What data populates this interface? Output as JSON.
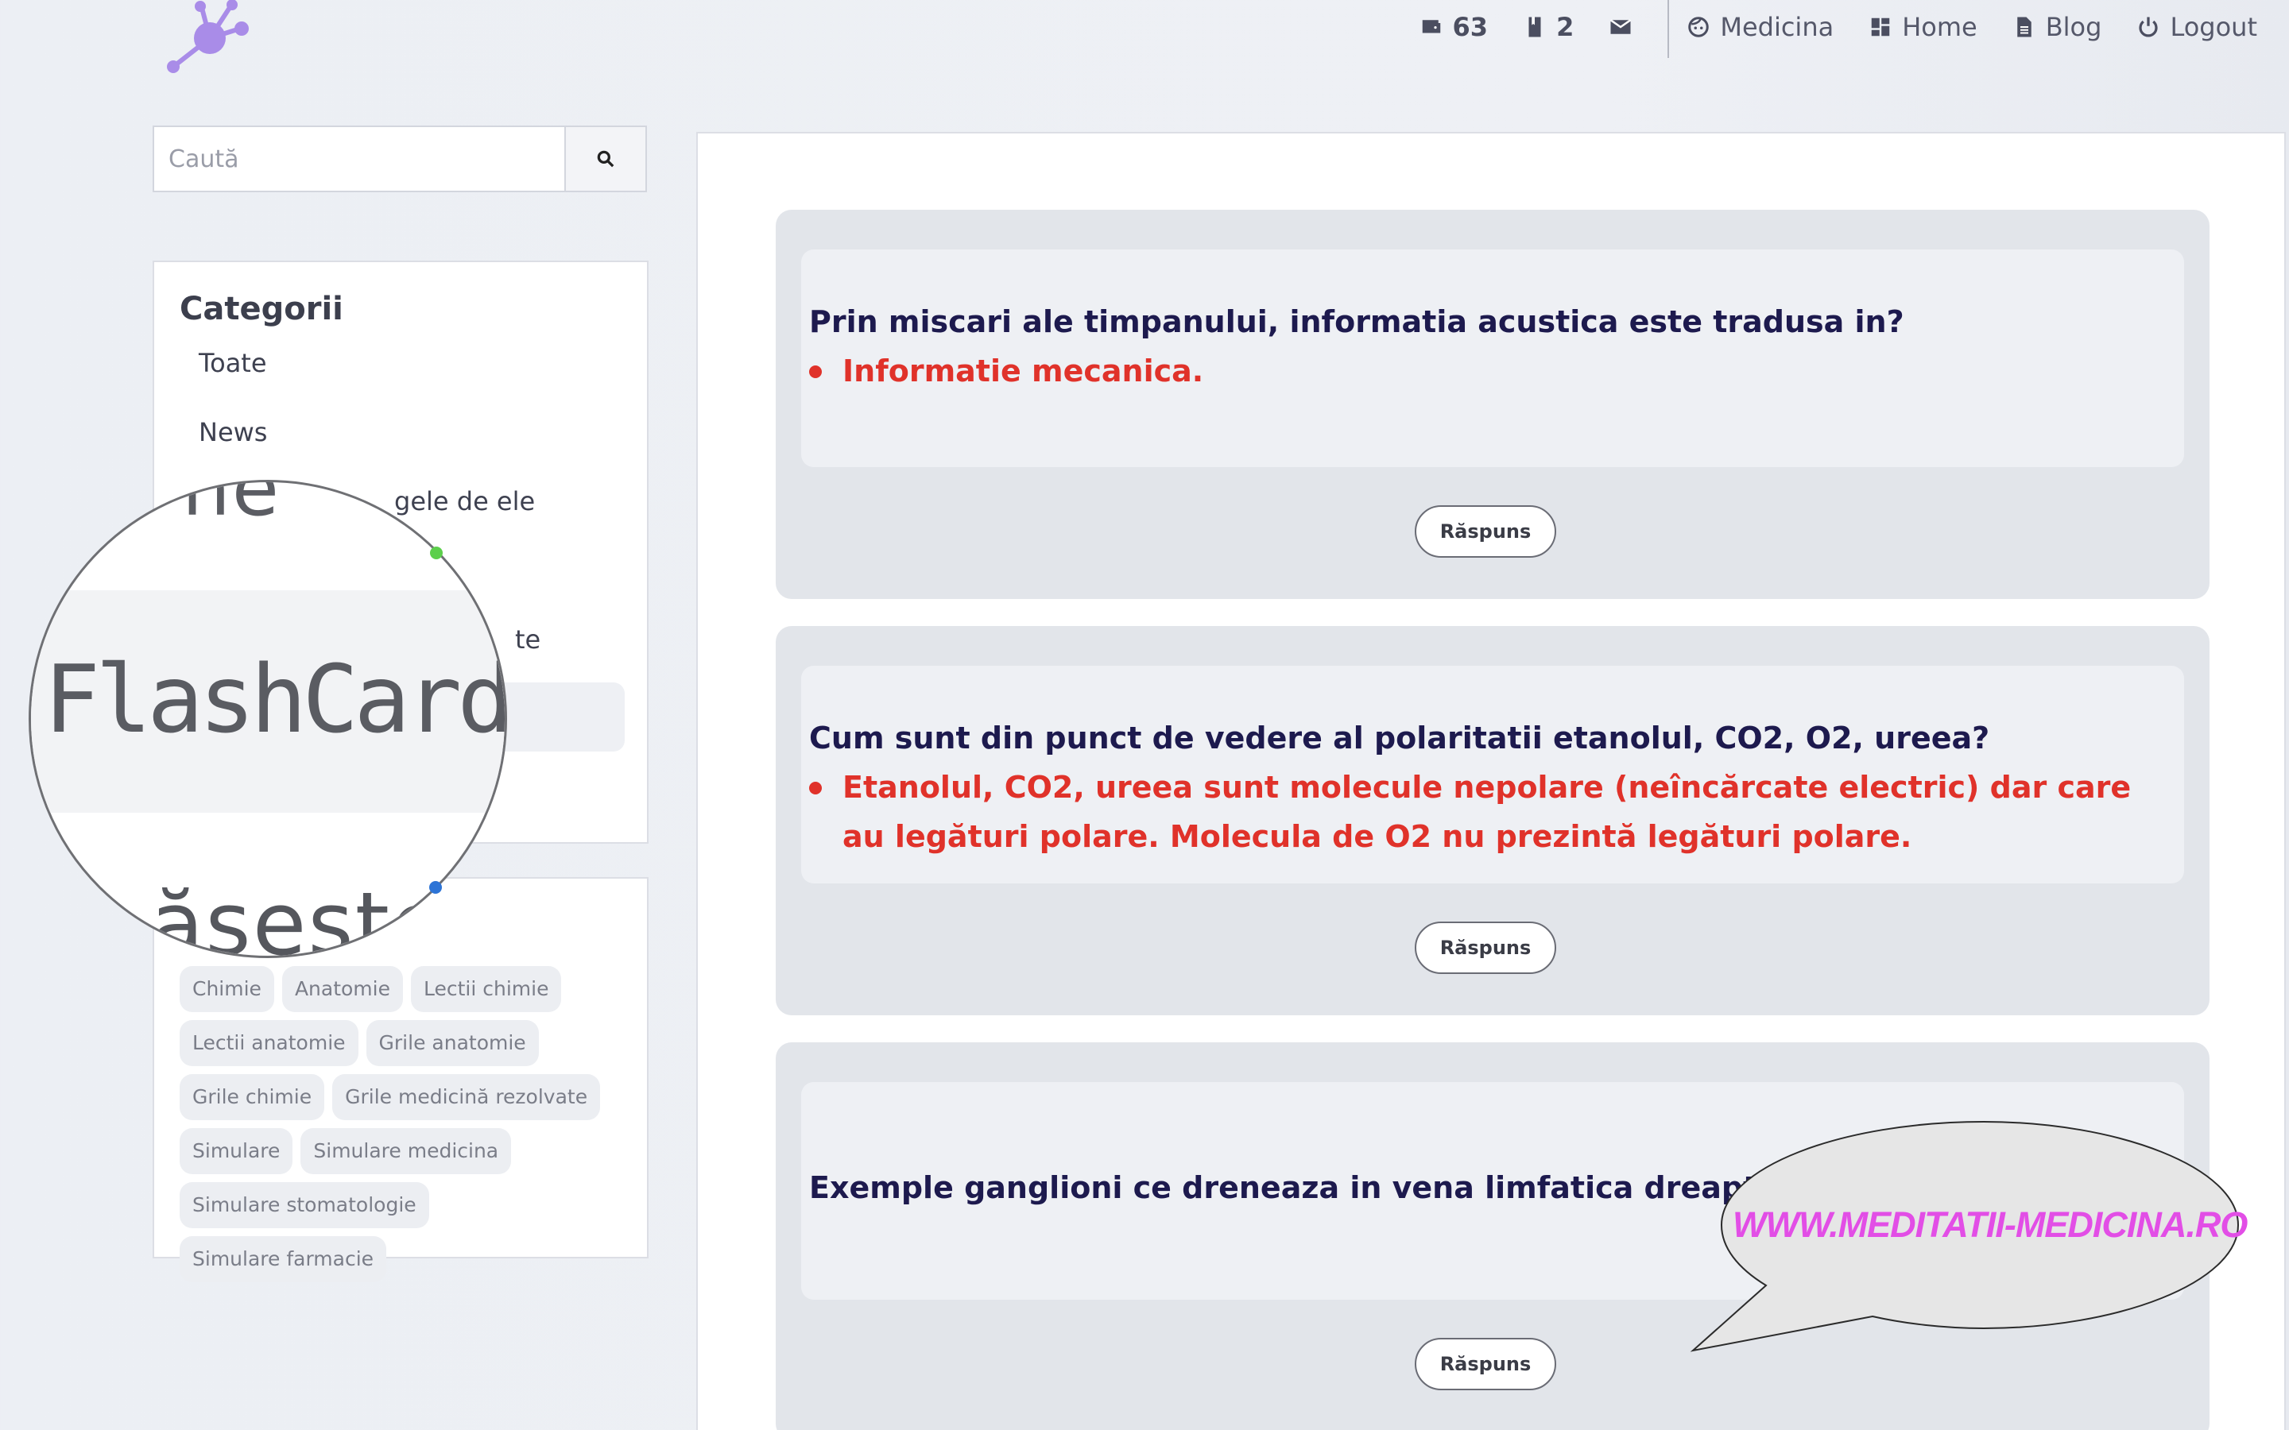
{
  "topnav": {
    "wallet_count": "63",
    "book_count": "2",
    "profile_label": "Medicina",
    "home_label": "Home",
    "blog_label": "Blog",
    "logout_label": "Logout"
  },
  "search": {
    "placeholder": "Caută"
  },
  "categories": {
    "title": "Categorii",
    "items": [
      "Toate",
      "News",
      "gele de ele",
      "",
      "te",
      ""
    ]
  },
  "magnifier": {
    "top_fragment": "he",
    "text": "FlashCards",
    "bottom_fragment": "ăseste c"
  },
  "tags": {
    "items": [
      "Chimie",
      "Anatomie",
      "Lectii chimie",
      "Lectii anatomie",
      "Grile anatomie",
      "Grile chimie",
      "Grile medicină rezolvate",
      "Simulare",
      "Simulare medicina",
      "Simulare stomatologie",
      "Simulare farmacie"
    ]
  },
  "cards": [
    {
      "question": "Prin miscari ale timpanului, informatia acustica este tradusa in?",
      "answer": "Informatie mecanica.",
      "button": "Răspuns"
    },
    {
      "question": "Cum sunt din punct de vedere al polaritatii etanolul, CO2, O2, ureea?",
      "answer": "Etanolul, CO2, ureea sunt molecule nepolare (neîncărcate electric) dar care au legături polare. Molecula de O2 nu prezintă legături polare.",
      "button": "Răspuns"
    },
    {
      "question": "Exemple ganglioni ce dreneaza in vena limfatica dreapta?",
      "button": "Răspuns"
    }
  ],
  "watermark": "WWW.MEDITATII-MEDICINA.RO",
  "colors": {
    "accent": "#e0322a",
    "logo": "#a98ce8",
    "watermark": "#e24ee6"
  }
}
